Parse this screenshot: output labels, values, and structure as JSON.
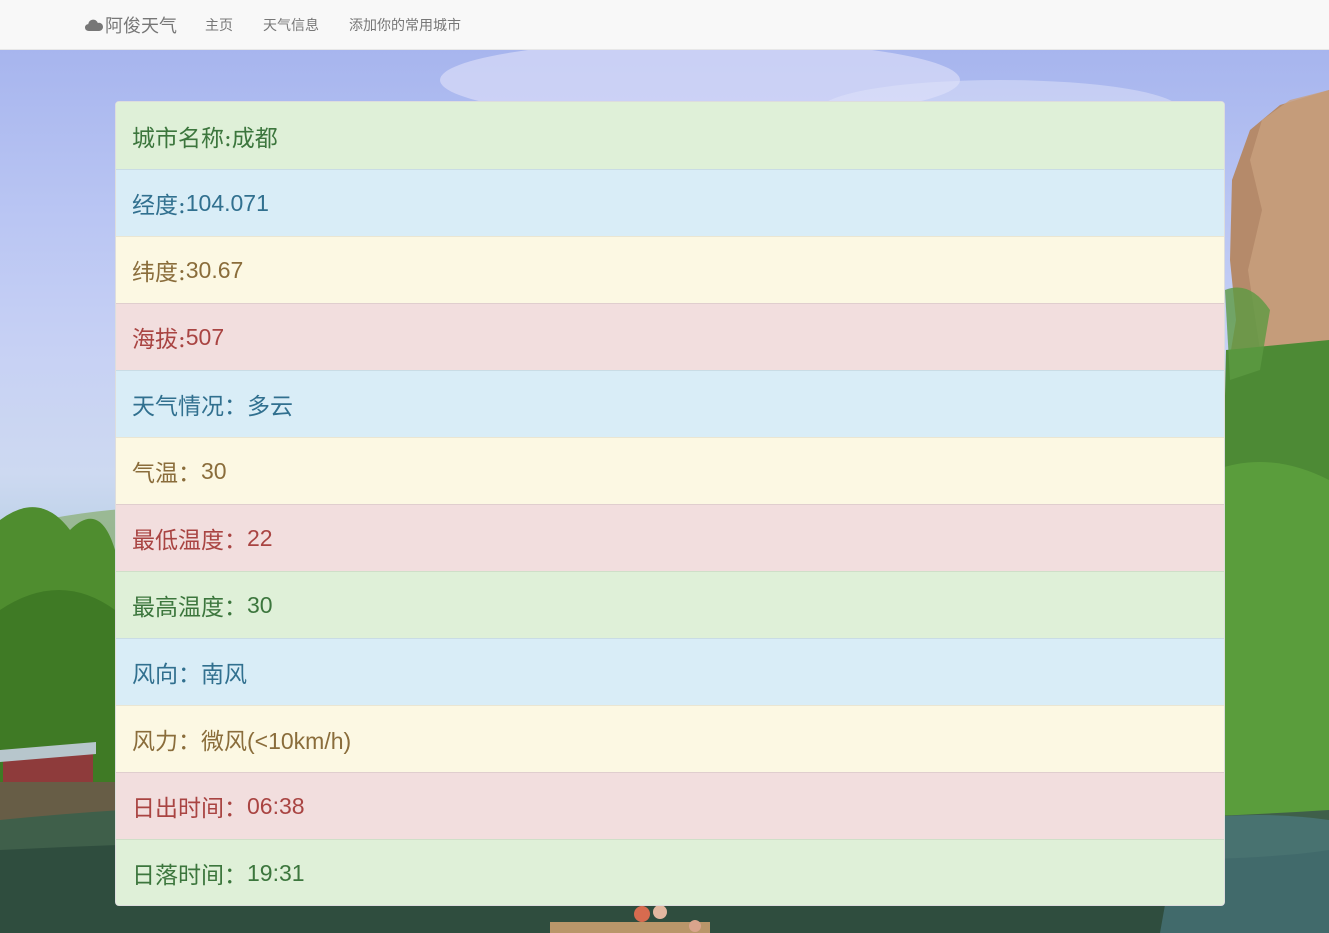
{
  "navbar": {
    "brand_label": "阿俊天气",
    "brand_icon": "cloud-icon",
    "links": [
      {
        "label": "主页"
      },
      {
        "label": "天气信息"
      },
      {
        "label": "添加你的常用城市"
      }
    ]
  },
  "weather": {
    "rows": [
      {
        "label": "城市名称: ",
        "value": "成都",
        "style": "success"
      },
      {
        "label": "经度: ",
        "value": "104.071",
        "style": "info"
      },
      {
        "label": "纬度: ",
        "value": "30.67",
        "style": "warning"
      },
      {
        "label": "海拔:",
        "value": "507",
        "style": "danger"
      },
      {
        "label": "天气情况：",
        "value": "多云",
        "style": "info"
      },
      {
        "label": "气温：",
        "value": "30",
        "style": "warning"
      },
      {
        "label": "最低温度：",
        "value": "22",
        "style": "danger"
      },
      {
        "label": "最高温度：",
        "value": "30",
        "style": "success"
      },
      {
        "label": "风向：",
        "value": "南风",
        "style": "info"
      },
      {
        "label": "风力：",
        "value": "微风(<10km/h)",
        "style": "warning"
      },
      {
        "label": "日出时间：",
        "value": "06:38",
        "style": "danger"
      },
      {
        "label": "日落时间：",
        "value": "19:31",
        "style": "success"
      }
    ]
  },
  "colors": {
    "success_bg": "#dff0d8",
    "info_bg": "#d9edf7",
    "warning_bg": "#fcf8e3",
    "danger_bg": "#f2dede",
    "navbar_bg": "#f8f8f8",
    "nav_text": "#777777"
  }
}
